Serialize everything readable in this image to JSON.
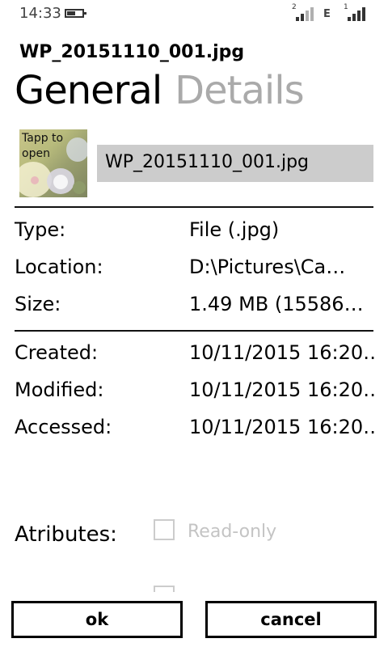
{
  "status_bar": {
    "time": "14:33",
    "network_type": "E",
    "sim1_label": "2",
    "sim2_label": "1",
    "battery_icon": "battery-icon",
    "signal_icon": "signal-icon"
  },
  "header": {
    "file_title": "WP_20151110_001.jpg",
    "tabs": [
      {
        "label": "General",
        "active": true
      },
      {
        "label": "Details",
        "active": false
      }
    ]
  },
  "thumbnail": {
    "label": "Tapp to open"
  },
  "name_field": {
    "value": "WP_20151110_001.jpg"
  },
  "properties": [
    {
      "label": "Type:",
      "value": "File (.jpg)"
    },
    {
      "label": "Location:",
      "value": "D:\\Pictures\\Ca…"
    },
    {
      "label": "Size:",
      "value": "1.49 MB (15586…"
    }
  ],
  "dates": [
    {
      "label": "Created:",
      "value": "10/11/2015 16:20…"
    },
    {
      "label": "Modified:",
      "value": "10/11/2015 16:20…"
    },
    {
      "label": "Accessed:",
      "value": "10/11/2015 16:20…"
    }
  ],
  "attributes": {
    "label": "Atributes:",
    "options": [
      {
        "label": "Read-only",
        "checked": false
      }
    ]
  },
  "buttons": {
    "ok": "ok",
    "cancel": "cancel"
  },
  "colors": {
    "background": "#ffffff",
    "inactive_tab": "#aaaaaa",
    "field_bg": "#cccccc",
    "disabled_text": "#c4c4c4"
  }
}
